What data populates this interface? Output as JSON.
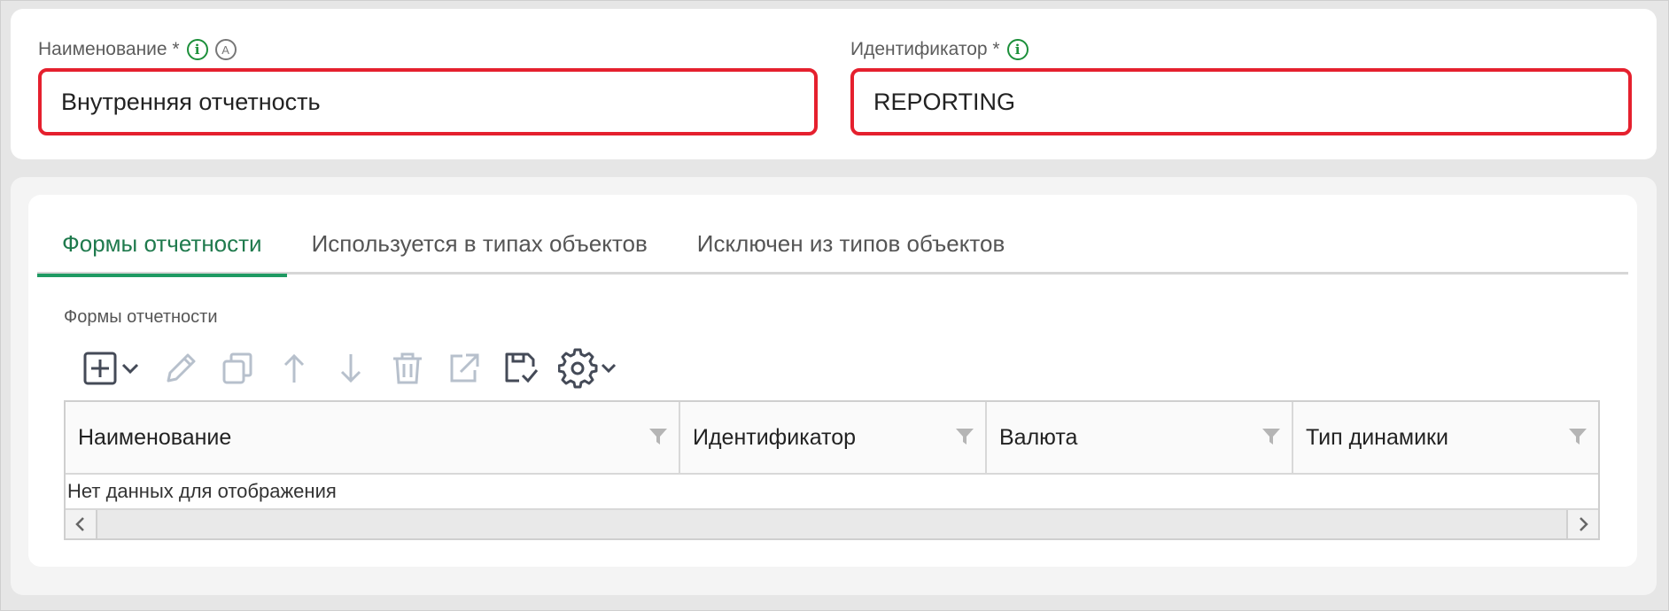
{
  "form": {
    "name_label": "Наименование *",
    "name_value": "Внутренняя отчетность",
    "id_label": "Идентификатор *",
    "id_value": "REPORTING",
    "info_icon_glyph": "i",
    "auto_icon_glyph": "A"
  },
  "tabs": [
    {
      "label": "Формы отчетности",
      "active": true
    },
    {
      "label": "Используется в типах объектов",
      "active": false
    },
    {
      "label": "Исключен из типов объектов",
      "active": false
    }
  ],
  "section": {
    "label": "Формы отчетности"
  },
  "toolbar": {
    "icons": [
      "add-icon",
      "edit-icon",
      "copy-icon",
      "move-up-icon",
      "move-down-icon",
      "delete-icon",
      "open-external-icon",
      "save-icon",
      "settings-icon"
    ]
  },
  "grid": {
    "columns": [
      "Наименование",
      "Идентификатор",
      "Валюта",
      "Тип динамики"
    ],
    "empty_text": "Нет данных для отображения"
  },
  "colors": {
    "accent": "#1f9a63",
    "error_border": "#e5202e",
    "info_green": "#1c8f3a"
  }
}
